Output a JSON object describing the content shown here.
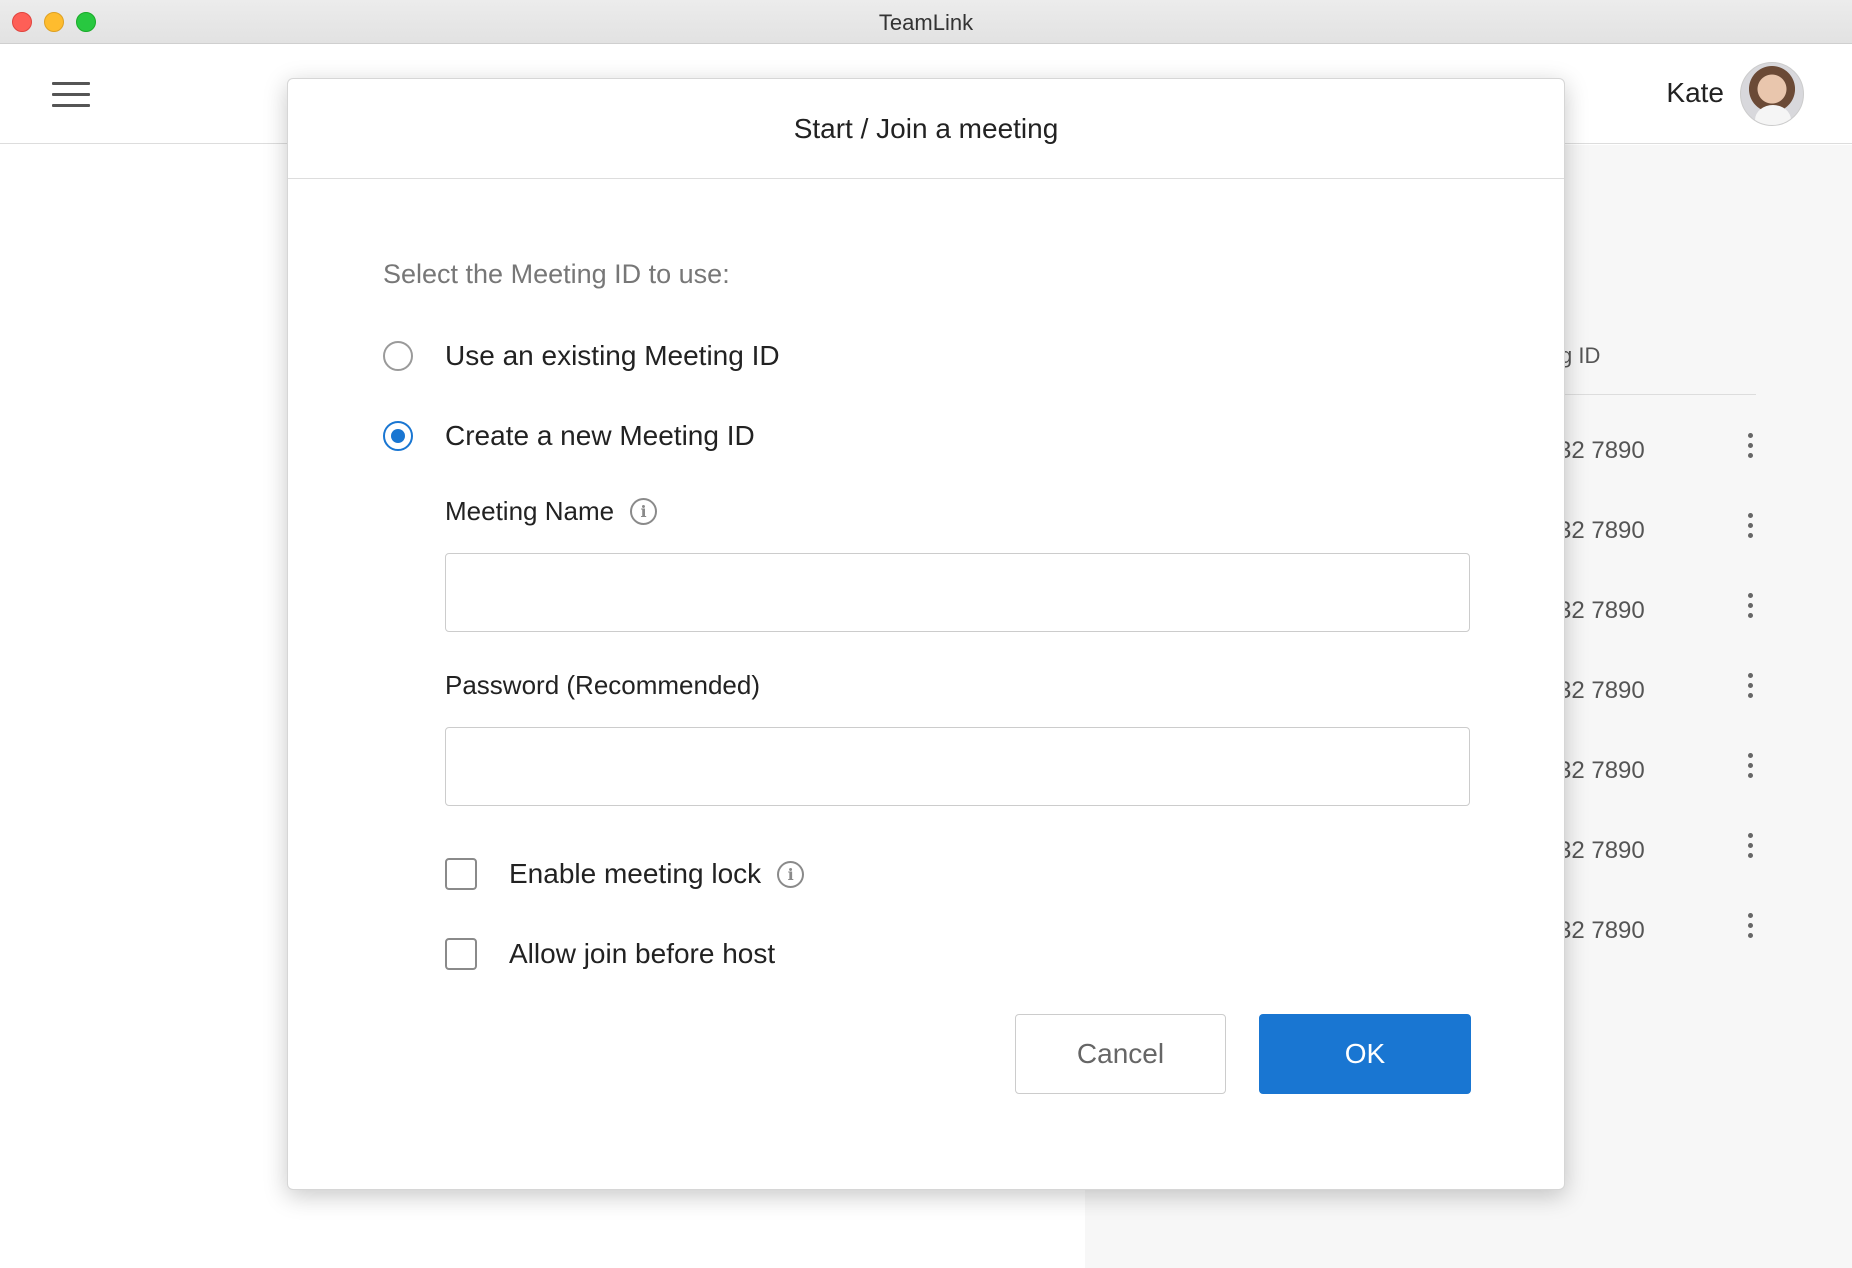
{
  "window": {
    "title": "TeamLink"
  },
  "header": {
    "user_name": "Kate"
  },
  "background_list": {
    "column_header": "g ID",
    "rows": [
      "32 7890",
      "32 7890",
      "32 7890",
      "32 7890",
      "32 7890",
      "32 7890",
      "32 7890"
    ]
  },
  "modal": {
    "title": "Start / Join a meeting",
    "prompt": "Select the Meeting ID to use:",
    "options": [
      {
        "label": "Use an existing Meeting ID",
        "selected": false
      },
      {
        "label": "Create a new Meeting ID",
        "selected": true
      }
    ],
    "meeting_name": {
      "label": "Meeting Name",
      "value": ""
    },
    "password": {
      "label": "Password (Recommended)",
      "value": ""
    },
    "checkboxes": [
      {
        "label": "Enable meeting lock",
        "checked": false
      },
      {
        "label": "Allow join before host",
        "checked": false
      }
    ],
    "cancel_label": "Cancel",
    "ok_label": "OK"
  },
  "colors": {
    "accent": "#1976d2"
  }
}
